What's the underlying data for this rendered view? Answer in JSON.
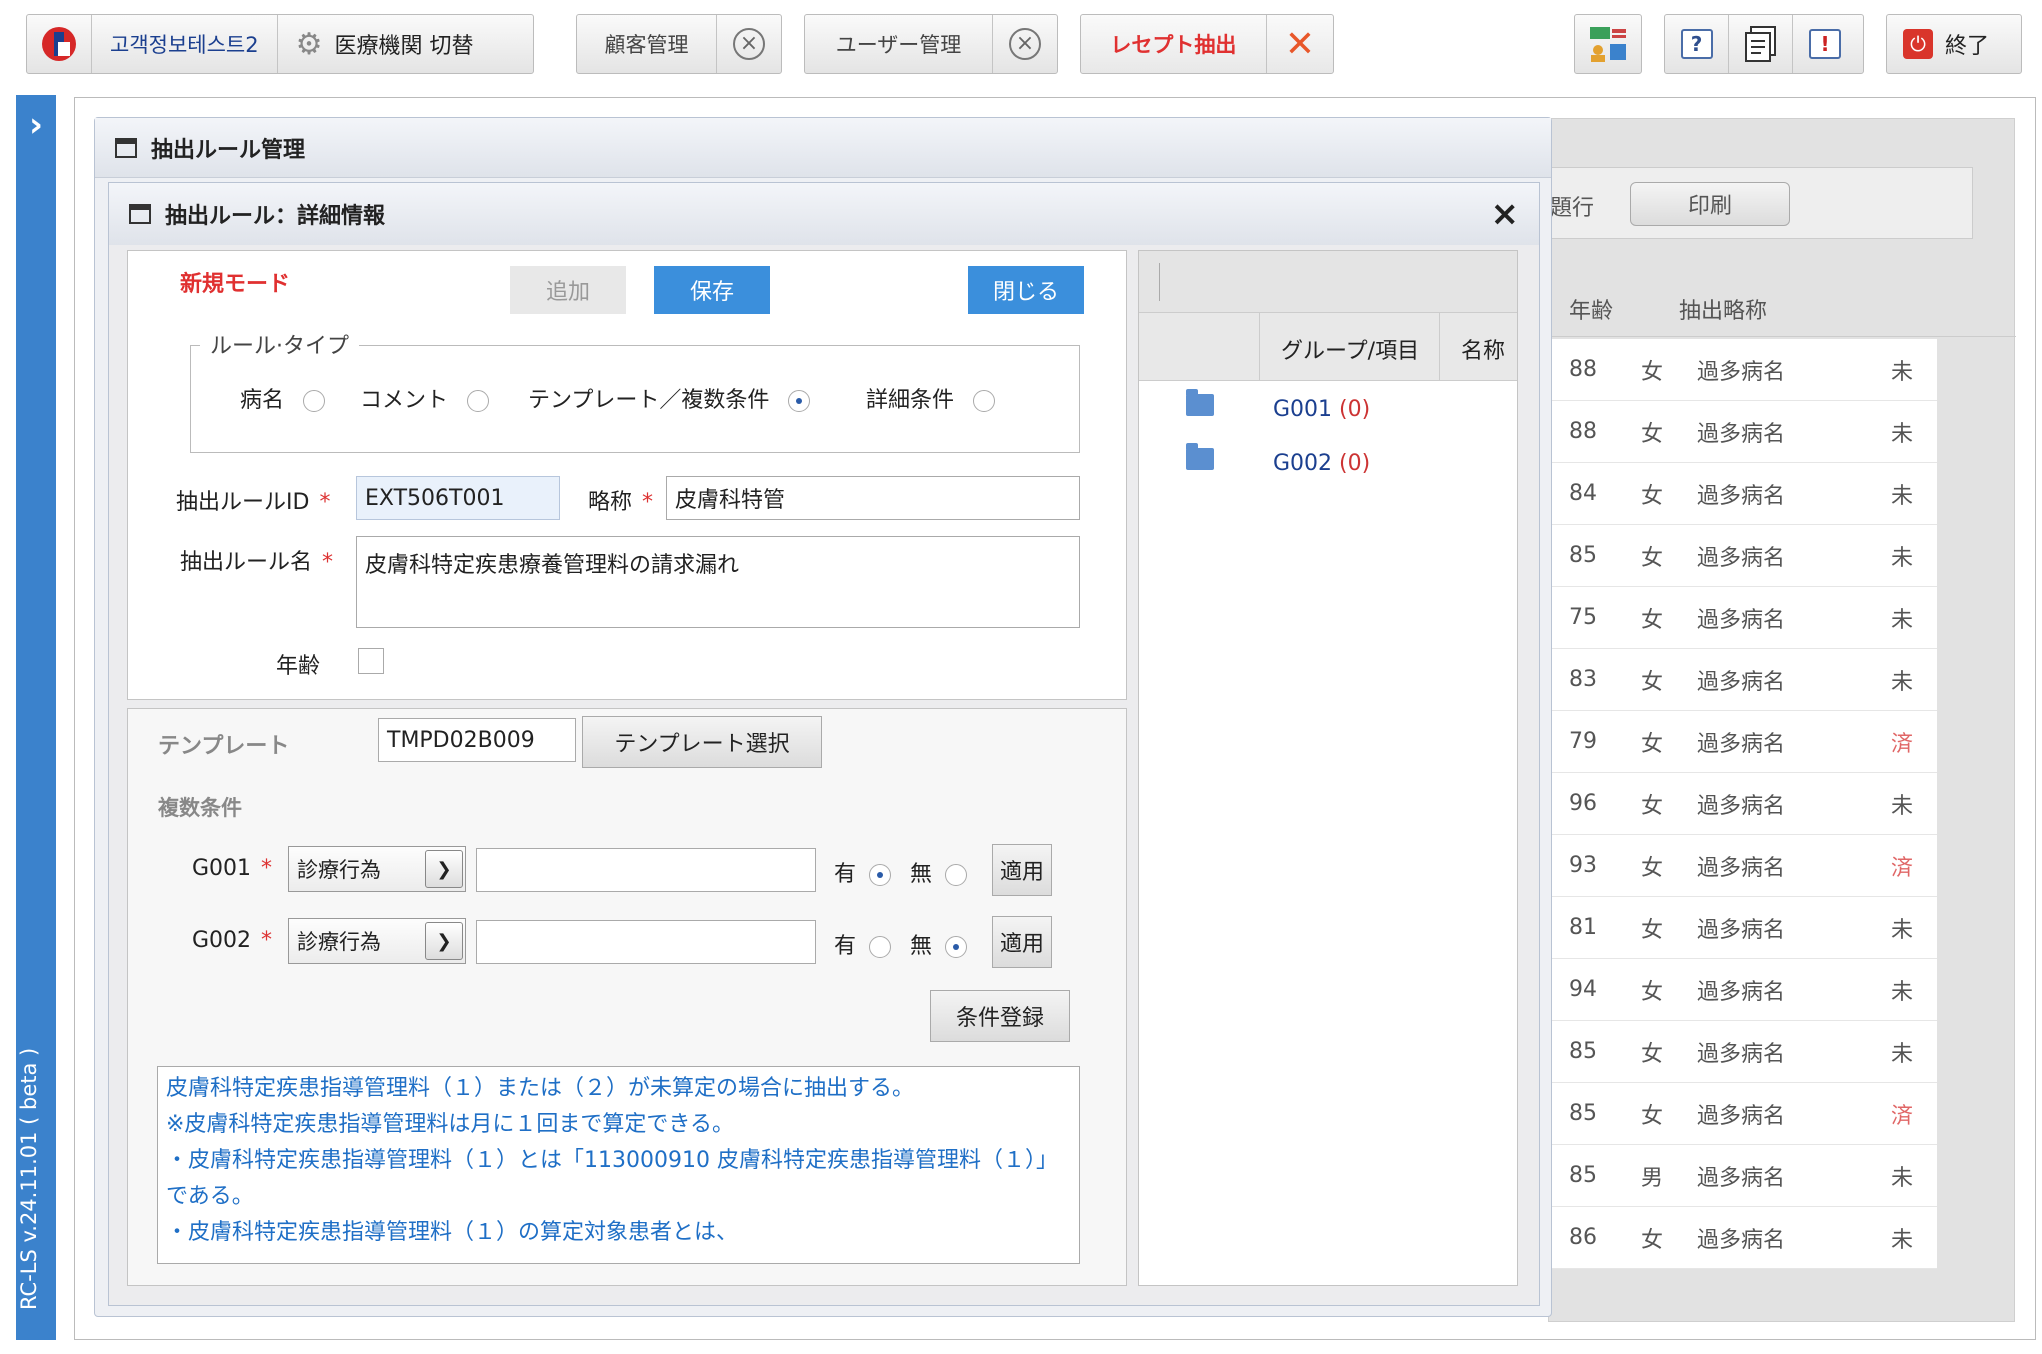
{
  "toolbar": {
    "org_name": "고객정보테스트2",
    "switch_label": "医療機関 切替",
    "tabs": [
      {
        "label": "顧客管理"
      },
      {
        "label": "ユーザー管理"
      },
      {
        "label": "レセプト抽出"
      }
    ],
    "exit_label": "終了",
    "help_icon_glyph": "?",
    "alert_icon_glyph": "!"
  },
  "sidebar": {
    "expand_glyph": "›",
    "version": "RC-LS v.24.11.01 ( beta )"
  },
  "background": {
    "exec_label": "題行",
    "print_label": "印刷",
    "col_age": "年齢",
    "col_abbr": "抽出略称",
    "rows": [
      {
        "age": "88",
        "sex": "女",
        "name": "過多病名",
        "status": "未"
      },
      {
        "age": "88",
        "sex": "女",
        "name": "過多病名",
        "status": "未"
      },
      {
        "age": "84",
        "sex": "女",
        "name": "過多病名",
        "status": "未"
      },
      {
        "age": "85",
        "sex": "女",
        "name": "過多病名",
        "status": "未"
      },
      {
        "age": "75",
        "sex": "女",
        "name": "過多病名",
        "status": "未"
      },
      {
        "age": "83",
        "sex": "女",
        "name": "過多病名",
        "status": "未"
      },
      {
        "age": "79",
        "sex": "女",
        "name": "過多病名",
        "status": "済"
      },
      {
        "age": "96",
        "sex": "女",
        "name": "過多病名",
        "status": "未"
      },
      {
        "age": "93",
        "sex": "女",
        "name": "過多病名",
        "status": "済"
      },
      {
        "age": "81",
        "sex": "女",
        "name": "過多病名",
        "status": "未"
      },
      {
        "age": "94",
        "sex": "女",
        "name": "過多病名",
        "status": "未"
      },
      {
        "age": "85",
        "sex": "女",
        "name": "過多病名",
        "status": "未"
      },
      {
        "age": "85",
        "sex": "女",
        "name": "過多病名",
        "status": "済"
      },
      {
        "age": "85",
        "sex": "男",
        "name": "過多病名",
        "status": "未"
      },
      {
        "age": "86",
        "sex": "女",
        "name": "過多病名",
        "status": "未"
      }
    ]
  },
  "outer_dialog": {
    "title": "抽出ルール管理"
  },
  "detail_dialog": {
    "title": "抽出ルール：詳細情報",
    "close_glyph": "×",
    "mode": "新規モード",
    "add_label": "追加",
    "save_label": "保存",
    "close_label": "閉じる",
    "rule_type_legend": "ルール·タイプ",
    "rule_types": [
      {
        "label": "病名",
        "checked": false
      },
      {
        "label": "コメント",
        "checked": false
      },
      {
        "label": "テンプレート／複数条件",
        "checked": true
      },
      {
        "label": "詳細条件",
        "checked": false
      }
    ],
    "rule_id_label": "抽出ルールID",
    "rule_id_value": "EXT506T001",
    "abbr_label": "略称",
    "abbr_value": "皮膚科特管",
    "rule_name_label": "抽出ルール名",
    "rule_name_value": "皮膚科特定疾患療養管理料の請求漏れ",
    "age_label": "年齢",
    "required_mark": "*",
    "template_label": "テンプレート",
    "template_value": "TMPD02B009",
    "template_select_label": "テンプレート選択",
    "multi_cond_label": "複数条件",
    "conditions": [
      {
        "group": "G001",
        "type": "診療行為",
        "value": "",
        "yes_label": "有",
        "no_label": "無",
        "yes_checked": true,
        "apply_label": "適用"
      },
      {
        "group": "G002",
        "type": "診療行為",
        "value": "",
        "yes_label": "有",
        "no_label": "無",
        "yes_checked": false,
        "apply_label": "適用"
      }
    ],
    "register_label": "条件登録",
    "description_lines": [
      "皮膚科特定疾患指導管理料（１）または（２）が未算定の場合に抽出する。",
      "※皮膚科特定疾患指導管理料は月に１回まで算定できる。",
      "・皮膚科特定疾患指導管理料（１）とは「113000910 皮膚科特定疾患指導管理料（１）」である。",
      "・皮膚科特定疾患指導管理料（１）の算定対象患者とは、"
    ],
    "tree": {
      "col_group": "グループ/項目",
      "col_name": "名称",
      "items": [
        {
          "label": "G001",
          "count": "(0)"
        },
        {
          "label": "G002",
          "count": "(0)"
        }
      ]
    }
  },
  "colors": {
    "accent": "#3b8fdc",
    "required": "#d33333",
    "sidebar": "#3b82cc",
    "done": "#e06666"
  }
}
